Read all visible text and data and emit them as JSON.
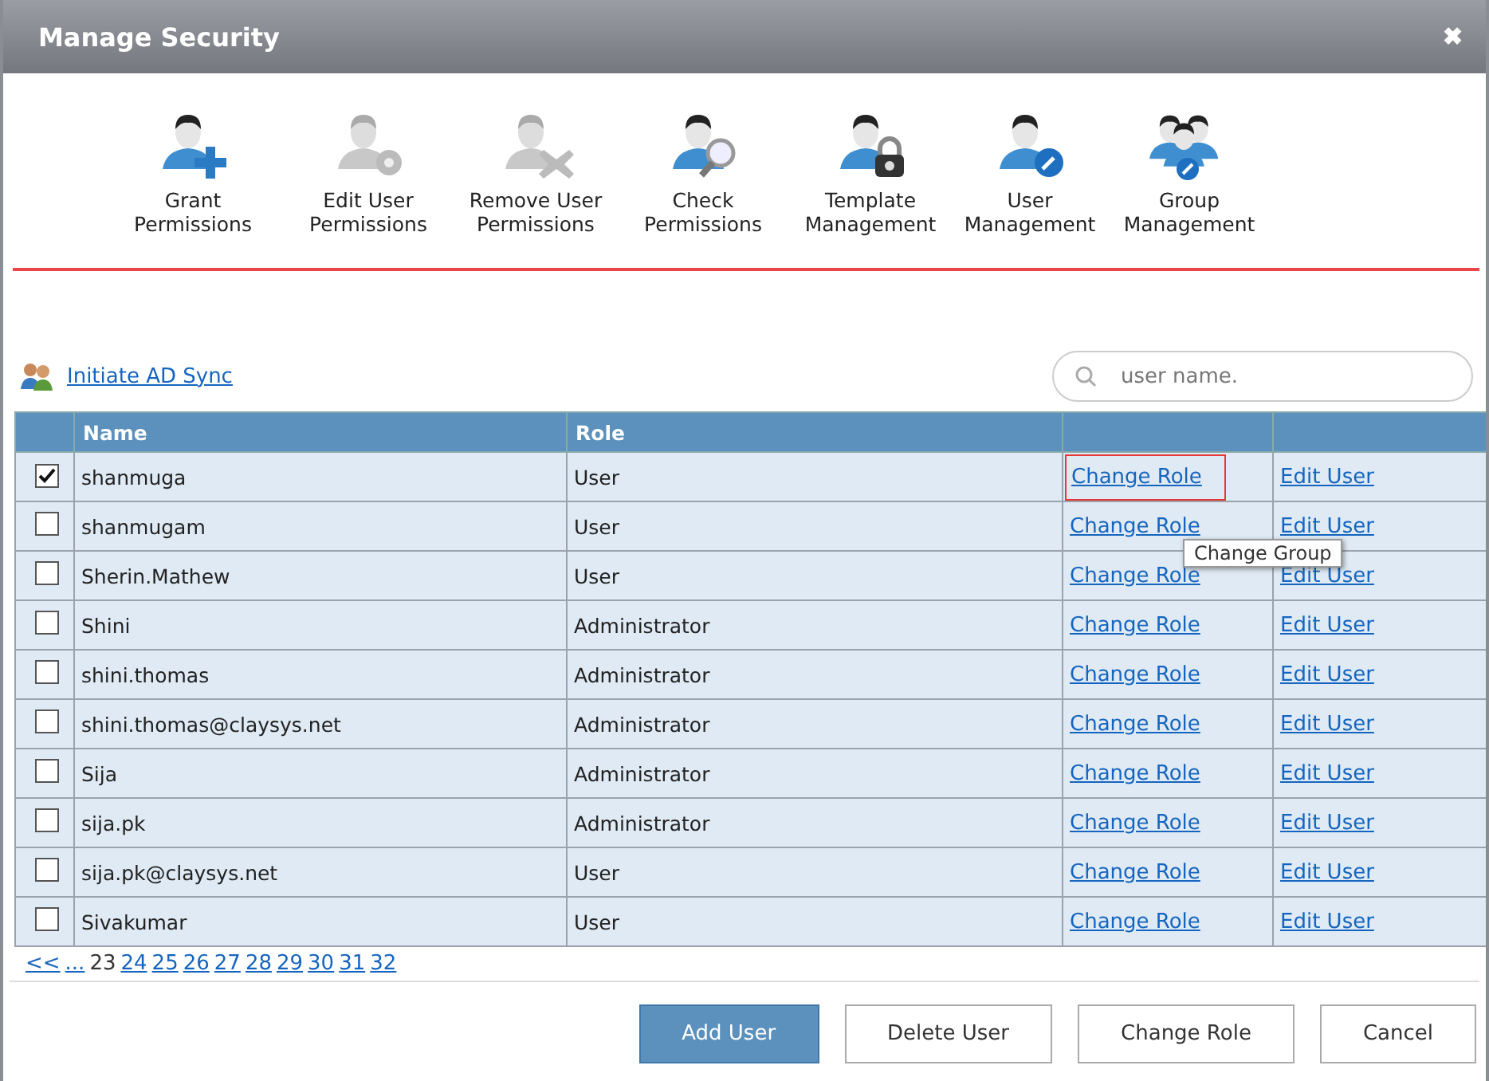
{
  "window": {
    "title": "Manage Security",
    "close": "✖"
  },
  "tools": [
    {
      "kind": "grant",
      "label": "Grant Permissions",
      "disabled": false
    },
    {
      "kind": "edit",
      "label": "Edit User Permissions",
      "disabled": true
    },
    {
      "kind": "remove",
      "label": "Remove User Permissions",
      "disabled": true
    },
    {
      "kind": "check",
      "label": "Check Permissions",
      "disabled": false
    },
    {
      "kind": "template",
      "label": "Template Management",
      "disabled": false
    },
    {
      "kind": "user",
      "label": "User Management",
      "disabled": false
    },
    {
      "kind": "group",
      "label": "Group Management",
      "disabled": false
    }
  ],
  "sync_link": "Initiate AD Sync",
  "search": {
    "placeholder": "user name."
  },
  "table": {
    "columns": [
      "Name",
      "Role"
    ],
    "rows": [
      {
        "name": "shanmuga",
        "role": "User",
        "change_link": "Change Role",
        "edit_link": "Edit User",
        "checked": true,
        "hovered": true
      },
      {
        "name": "shanmugam",
        "role": "User",
        "change_link": "Change Role",
        "edit_link": "Edit User",
        "checked": false,
        "hovered": false
      },
      {
        "name": "Sherin.Mathew",
        "role": "User",
        "change_link": "Change Role",
        "edit_link": "Edit User",
        "checked": false,
        "hovered": false
      },
      {
        "name": "Shini",
        "role": "Administrator",
        "change_link": "Change Role",
        "edit_link": "Edit User",
        "checked": false,
        "hovered": false
      },
      {
        "name": "shini.thomas",
        "role": "Administrator",
        "change_link": "Change Role",
        "edit_link": "Edit User",
        "checked": false,
        "hovered": false
      },
      {
        "name": "shini.thomas@claysys.net",
        "role": "Administrator",
        "change_link": "Change Role",
        "edit_link": "Edit User",
        "checked": false,
        "hovered": false
      },
      {
        "name": "Sija",
        "role": "Administrator",
        "change_link": "Change Role",
        "edit_link": "Edit User",
        "checked": false,
        "hovered": false
      },
      {
        "name": "sija.pk",
        "role": "Administrator",
        "change_link": "Change Role",
        "edit_link": "Edit User",
        "checked": false,
        "hovered": false
      },
      {
        "name": "sija.pk@claysys.net",
        "role": "User",
        "change_link": "Change Role",
        "edit_link": "Edit User",
        "checked": false,
        "hovered": false
      },
      {
        "name": "Sivakumar",
        "role": "User",
        "change_link": "Change Role",
        "edit_link": "Edit User",
        "checked": false,
        "hovered": false
      }
    ]
  },
  "tooltip": "Change Group",
  "pager": [
    {
      "label": "<<",
      "selected": false
    },
    {
      "label": "...",
      "selected": false
    },
    {
      "label": "23",
      "selected": true
    },
    {
      "label": "24",
      "selected": false
    },
    {
      "label": "25",
      "selected": false
    },
    {
      "label": "26",
      "selected": false
    },
    {
      "label": "27",
      "selected": false
    },
    {
      "label": "28",
      "selected": false
    },
    {
      "label": "29",
      "selected": false
    },
    {
      "label": "30",
      "selected": false
    },
    {
      "label": "31",
      "selected": false
    },
    {
      "label": "32",
      "selected": false
    }
  ],
  "buttons": [
    {
      "label": "Add User",
      "primary": true
    },
    {
      "label": "Delete User",
      "primary": false
    },
    {
      "label": "Change Role",
      "primary": false
    },
    {
      "label": "Cancel",
      "primary": false
    }
  ]
}
